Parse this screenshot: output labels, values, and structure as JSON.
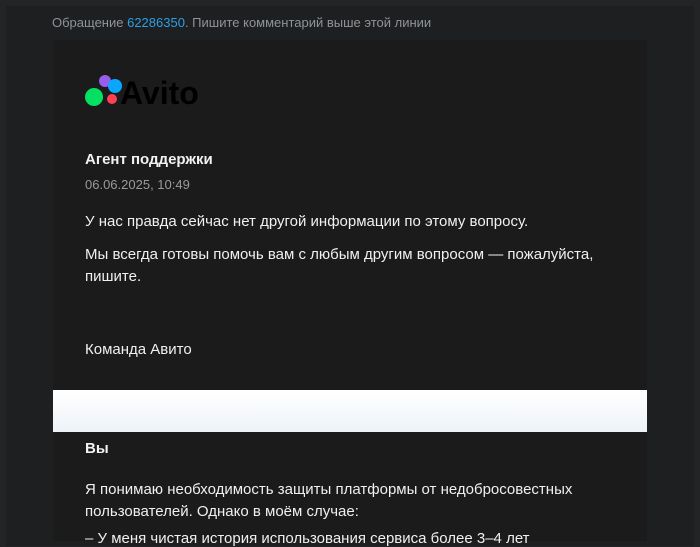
{
  "header": {
    "prefix": "Обращение ",
    "ticket_number": "62286350",
    "suffix": ". Пишите комментарий выше этой линии"
  },
  "logo": {
    "wordmark": "Avito",
    "colors": [
      "#965eeb",
      "#0aa6ff",
      "#04e061",
      "#ff4053"
    ]
  },
  "agent_message": {
    "sender": "Агент поддержки",
    "timestamp": "06.06.2025, 10:49",
    "paragraphs": [
      "У нас правда сейчас нет другой информации по этому вопросу.",
      "Мы всегда готовы помочь вам с любым другим вопросом — пожалуйста, пишите."
    ],
    "signature": "Команда Авито"
  },
  "user_message": {
    "sender": "Вы",
    "paragraph": "Я понимаю необходимость защиты платформы от недобросовестных пользователей. Однако в моём случае:",
    "list_item_partial": "– У меня чистая история использования сервиса более 3–4 лет"
  }
}
